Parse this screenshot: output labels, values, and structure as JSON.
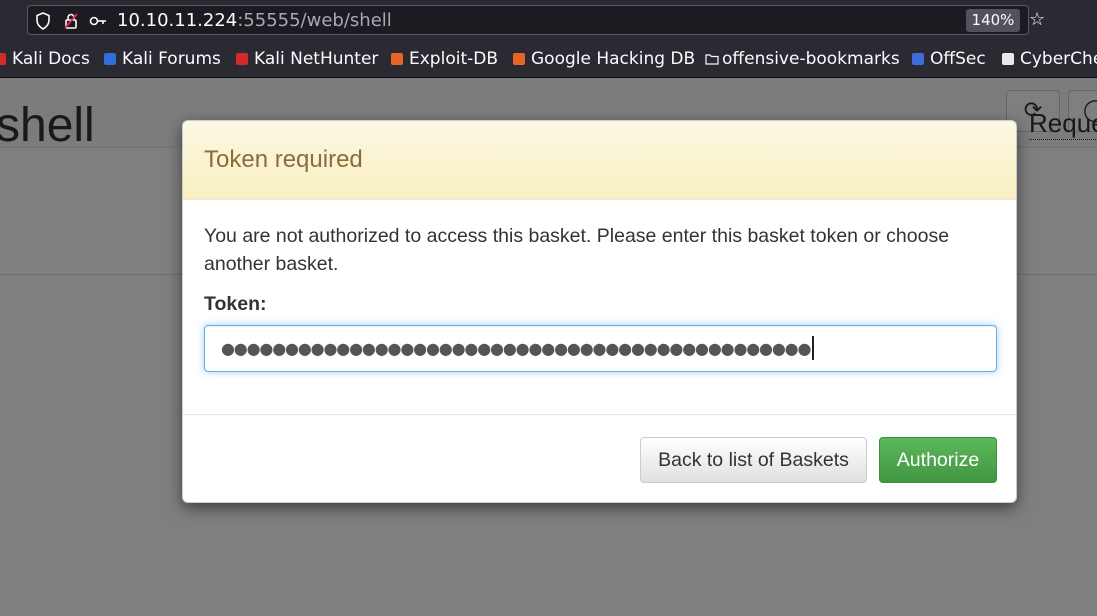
{
  "browser": {
    "url_host": "10.10.11.224",
    "url_path": ":55555/web/shell",
    "zoom": "140%",
    "bookmarks": [
      {
        "label": "Kali Docs",
        "color": "#d12b2b"
      },
      {
        "label": "Kali Forums",
        "color": "#2f6fd6"
      },
      {
        "label": "Kali NetHunter",
        "color": "#d12b2b"
      },
      {
        "label": "Exploit-DB",
        "color": "#e8652a"
      },
      {
        "label": "Google Hacking DB",
        "color": "#e8652a"
      },
      {
        "label": "offensive-bookmarks",
        "color": "#fbfbfe"
      },
      {
        "label": "OffSec",
        "color": "#3d6bd9"
      },
      {
        "label": "CyberChe",
        "color": "#e8e8e8"
      }
    ]
  },
  "page": {
    "basket_title": "shell",
    "requests_label": "Reque"
  },
  "modal": {
    "title": "Token required",
    "message": "You are not authorized to access this basket. Please enter this basket token or choose another basket.",
    "token_label": "Token:",
    "token_value": "●●●●●●●●●●●●●●●●●●●●●●●●●●●●●●●●●●●●●●●●●●●●●●",
    "back_button": "Back to list of Baskets",
    "authorize_button": "Authorize"
  },
  "colors": {
    "header_bg": "#fcf8e3",
    "title_text": "#8a6d3b",
    "success": "#449d44"
  }
}
